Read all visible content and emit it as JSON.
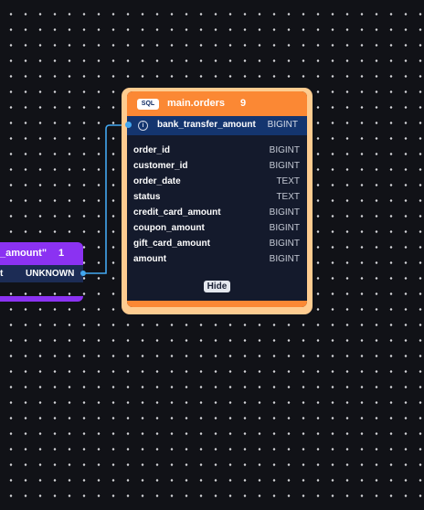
{
  "left_node": {
    "title": "_amount\"",
    "count": "1",
    "row": {
      "name": "t",
      "type": "UNKNOWN"
    },
    "color": "#8b32f2"
  },
  "orders_node": {
    "badge": "SQL",
    "title": "main.orders",
    "count": "9",
    "header_color": "#fb8834",
    "border_color": "#fecc90",
    "info_icon": "i",
    "pinned_column": {
      "name": "bank_transfer_amount",
      "type": "BIGINT"
    },
    "columns": [
      {
        "name": "order_id",
        "type": "BIGINT"
      },
      {
        "name": "customer_id",
        "type": "BIGINT"
      },
      {
        "name": "order_date",
        "type": "TEXT"
      },
      {
        "name": "status",
        "type": "TEXT"
      },
      {
        "name": "credit_card_amount",
        "type": "BIGINT"
      },
      {
        "name": "coupon_amount",
        "type": "BIGINT"
      },
      {
        "name": "gift_card_amount",
        "type": "BIGINT"
      },
      {
        "name": "amount",
        "type": "BIGINT"
      }
    ],
    "hide_label": "Hide"
  },
  "edge_color": "#42a7f0"
}
